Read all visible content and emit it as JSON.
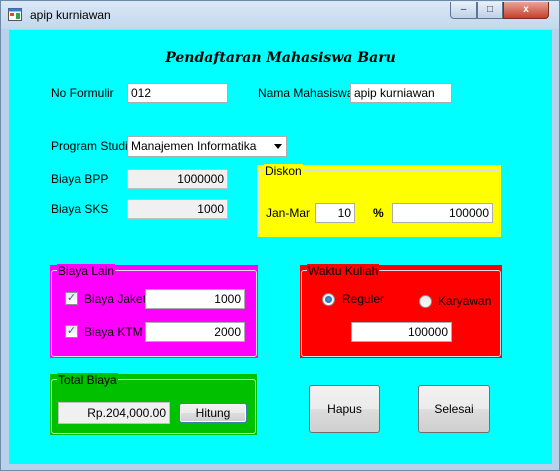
{
  "window": {
    "title": "apip kurniawan",
    "minimize": "–",
    "maximize": "□",
    "close": "x"
  },
  "heading": "Pendaftaran Mahasiswa Baru",
  "form": {
    "no_formulir_label": "No Formulir",
    "no_formulir_value": "012",
    "nama_label": "Nama Mahasiswa",
    "nama_value": "apip kurniawan",
    "prodi_label": "Program Studi",
    "prodi_value": "Manajemen Informatika",
    "bpp_label": "Biaya BPP",
    "bpp_value": "1000000",
    "sks_label": "Biaya SKS",
    "sks_value": "1000"
  },
  "diskon": {
    "title": "Diskon",
    "period_label": "Jan-Mar",
    "percent_value": "10",
    "percent_symbol": "%",
    "amount_value": "100000"
  },
  "biaya_lain": {
    "title": "Biaya Lain",
    "jaket_label": "Biaya Jaket",
    "jaket_checked": true,
    "jaket_value": "1000",
    "ktm_label": "Biaya KTM",
    "ktm_checked": true,
    "ktm_value": "2000"
  },
  "waktu_kuliah": {
    "title": "Waktu Kuliah",
    "reguler_label": "Reguler",
    "karyawan_label": "Karyawan",
    "selected": "Reguler",
    "value": "100000"
  },
  "total": {
    "title": "Total Biaya",
    "value": "Rp.204,000.00",
    "hitung_label": "Hitung"
  },
  "buttons": {
    "hapus_label": "Hapus",
    "selesai_label": "Selesai"
  },
  "colors": {
    "form_bg": "#00ffff",
    "diskon_bg": "#ffff00",
    "biaya_lain_bg": "#ff00ff",
    "waktu_kuliah_bg": "#ff0000",
    "total_bg": "#00c000"
  }
}
